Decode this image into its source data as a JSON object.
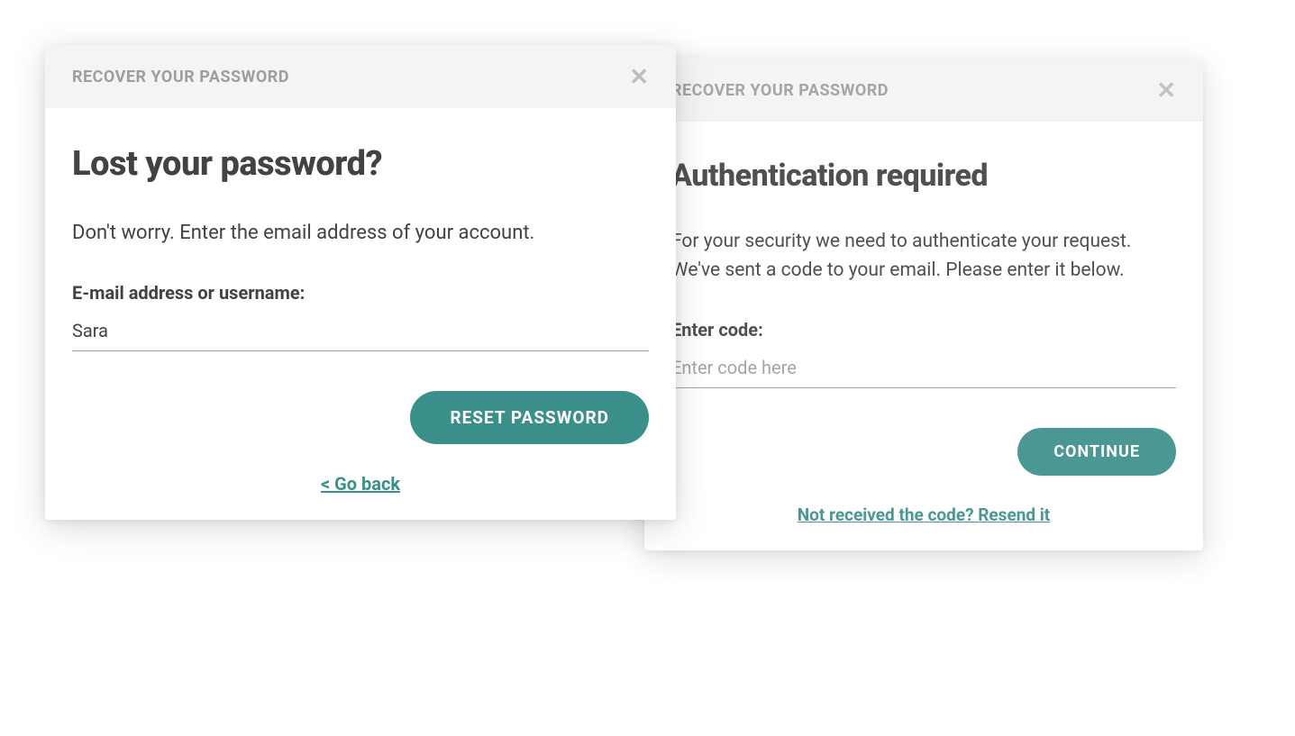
{
  "colors": {
    "accent": "#3b8f8a",
    "text": "#424242",
    "muted": "#9e9e9e",
    "header_bg": "#f4f4f4"
  },
  "dialog_front": {
    "header_title": "RECOVER YOUR PASSWORD",
    "heading": "Lost your password?",
    "description": "Don't worry. Enter the email address of your account.",
    "field_label": "E-mail address or username:",
    "input_value": "Sara",
    "button_label": "RESET PASSWORD",
    "back_link": "< Go back"
  },
  "dialog_back": {
    "header_title": "RECOVER YOUR PASSWORD",
    "heading": "Authentication required",
    "description": "For your security we need to authenticate your request. We've sent a code to your email. Please enter it below.",
    "field_label": "Enter code:",
    "input_placeholder": "Enter code here",
    "button_label": "CONTINUE",
    "resend_link": "Not received the code? Resend it"
  }
}
